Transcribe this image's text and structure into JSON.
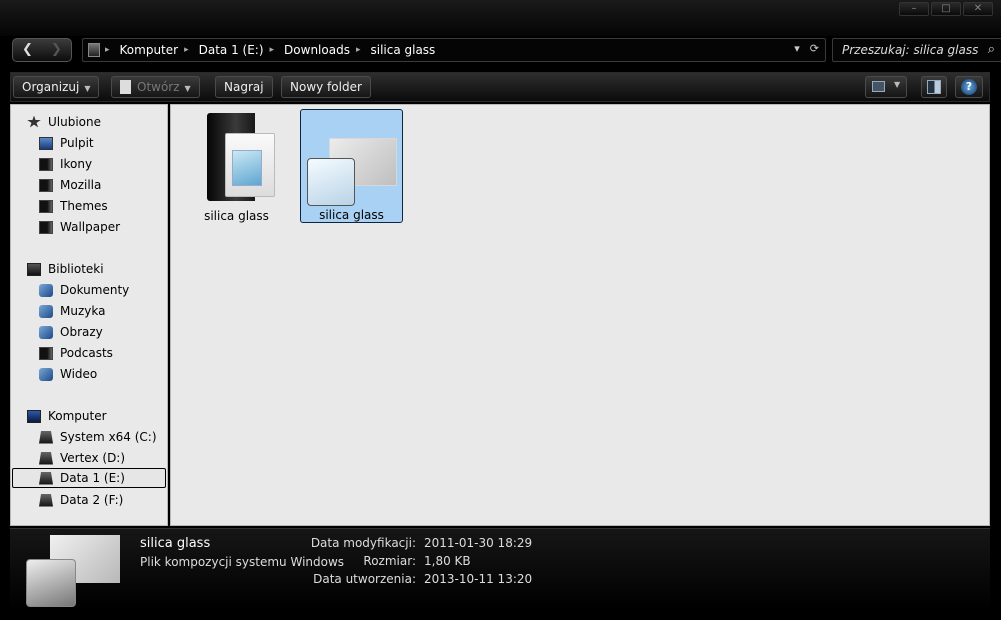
{
  "window": {
    "buttons": [
      {
        "label": "–",
        "name": "minimize-button"
      },
      {
        "label": "□",
        "name": "maximize-button"
      },
      {
        "label": "✕",
        "name": "close-button"
      }
    ]
  },
  "nav": {
    "back": "❮",
    "forward": "❯"
  },
  "address": {
    "crumbs": [
      "Komputer",
      "Data 1 (E:)",
      "Downloads",
      "silica glass"
    ],
    "dropdown": "▾",
    "refresh": "⟳"
  },
  "search": {
    "placeholder": "Przeszukaj: silica glass",
    "icon": "⌕"
  },
  "toolbar": {
    "organize": "Organizuj",
    "open": "Otwórz",
    "burn": "Nagraj",
    "new_folder": "Nowy folder",
    "help": "?"
  },
  "sidebar": {
    "favorites_title": "Ulubione",
    "favorites": [
      "Pulpit",
      "Ikony",
      "Mozilla",
      "Themes",
      "Wallpaper"
    ],
    "libraries_title": "Biblioteki",
    "libraries": [
      "Dokumenty",
      "Muzyka",
      "Obrazy",
      "Podcasts",
      "Wideo"
    ],
    "computer_title": "Komputer",
    "drives": [
      "System x64 (C:)",
      "Vertex (D:)",
      "Data 1 (E:)",
      "Data 2 (F:)"
    ]
  },
  "files": [
    {
      "name": "silica glass",
      "kind": "folder-icon"
    },
    {
      "name": "silica glass",
      "kind": "theme-file-icon",
      "selected": true
    }
  ],
  "details": {
    "title": "silica glass",
    "type": "Plik kompozycji systemu Windows",
    "modified_label": "Data modyfikacji:",
    "modified_value": "2011-01-30 18:29",
    "size_label": "Rozmiar:",
    "size_value": "1,80 KB",
    "created_label": "Data utworzenia:",
    "created_value": "2013-10-11 13:20"
  }
}
